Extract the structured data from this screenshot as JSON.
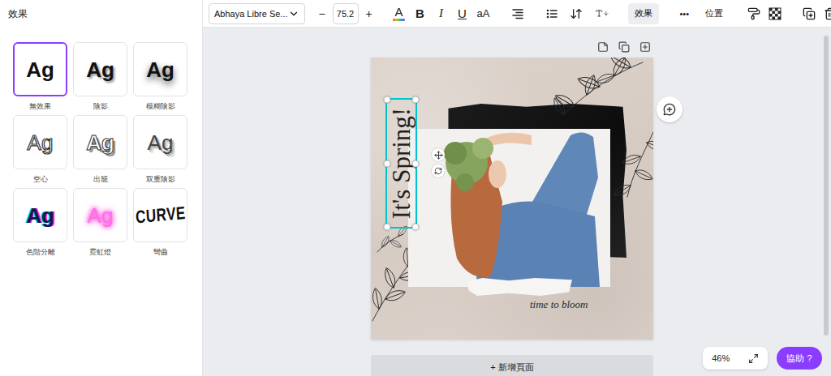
{
  "panel": {
    "title": "效果",
    "effects": [
      {
        "label": "無效果",
        "sample": "Ag",
        "kind": "none",
        "selected": true
      },
      {
        "label": "陰影",
        "sample": "Ag",
        "kind": "shadow",
        "selected": false
      },
      {
        "label": "模糊陰影",
        "sample": "Ag",
        "kind": "lift",
        "selected": false
      },
      {
        "label": "空心",
        "sample": "Ag",
        "kind": "hollow",
        "selected": false
      },
      {
        "label": "出籠",
        "sample": "Ag",
        "kind": "splice",
        "selected": false
      },
      {
        "label": "双重陰影",
        "sample": "Ag",
        "kind": "echo",
        "selected": false
      },
      {
        "label": "色階分離",
        "sample": "Ag",
        "kind": "glitch",
        "selected": false
      },
      {
        "label": "霓虹燈",
        "sample": "Ag",
        "kind": "neon",
        "selected": false
      },
      {
        "label": "彎曲",
        "sample": "CURVE",
        "kind": "curve",
        "selected": false
      }
    ]
  },
  "toolbar": {
    "font": "Abhaya Libre Se...",
    "decrease": "−",
    "size": "75.2",
    "increase": "+",
    "text_color": "A",
    "bold": "B",
    "italic": "I",
    "underline": "U",
    "case": "aA",
    "effects": {
      "label": "效果",
      "active": true
    },
    "more": "•••",
    "position": "位置"
  },
  "page": {
    "heading": "It's Spring!",
    "heading_selected": true,
    "caption": "time to bloom"
  },
  "add_page": "+ 新增頁面",
  "zoom": "46%",
  "help": "協助 ?"
}
